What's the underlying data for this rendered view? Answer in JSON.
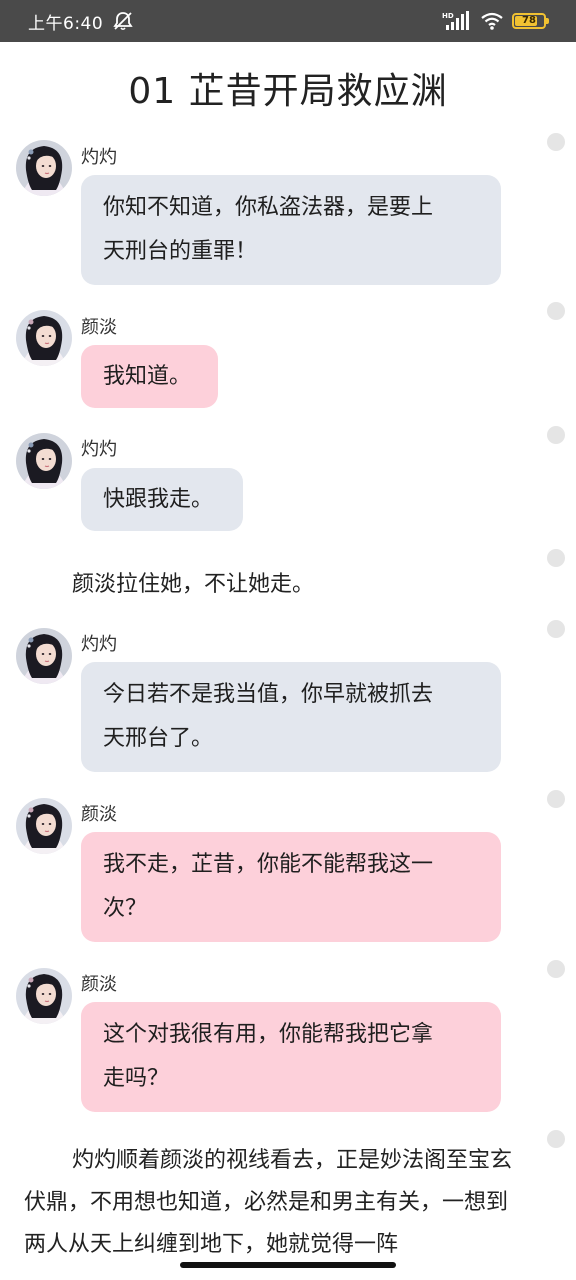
{
  "status_bar": {
    "time": "上午6:40",
    "network_label": "HD",
    "battery_level": 78,
    "battery_text": "78"
  },
  "title": "01 芷昔开局救应渊",
  "messages": [
    {
      "speaker": "灼灼",
      "lines": [
        "你知不知道，你私盗法器，是要上",
        "天刑台的重罪！"
      ],
      "style": "grey"
    },
    {
      "speaker": "颜淡",
      "lines": [
        "我知道。"
      ],
      "style": "pink"
    },
    {
      "speaker": "灼灼",
      "lines": [
        "快跟我走。"
      ],
      "style": "grey"
    },
    {
      "narration": "颜淡拉住她，不让她走。"
    },
    {
      "speaker": "灼灼",
      "lines": [
        "今日若不是我当值，你早就被抓去",
        "天邢台了。"
      ],
      "style": "grey"
    },
    {
      "speaker": "颜淡",
      "lines": [
        "我不走，芷昔，你能不能帮我这一",
        "次？"
      ],
      "style": "pink"
    },
    {
      "speaker": "颜淡",
      "lines": [
        "这个对我很有用，你能帮我把它拿",
        "走吗？"
      ],
      "style": "pink"
    }
  ],
  "paragraph": "灼灼顺着颜淡的视线看去，正是妙法阁至宝玄伏鼎，不用想也知道，必然是和男主有关，一想到两人从天上纠缠到地下，她就觉得一阵",
  "colors": {
    "grey_bubble": "#e3e7ee",
    "pink_bubble": "#fdd0da",
    "status_bar": "#4a4a4a",
    "battery": "#f1c232"
  },
  "icons": {
    "mute": "mute-bell-icon",
    "signal": "cellular-signal-icon",
    "wifi": "wifi-icon",
    "battery": "battery-icon"
  }
}
